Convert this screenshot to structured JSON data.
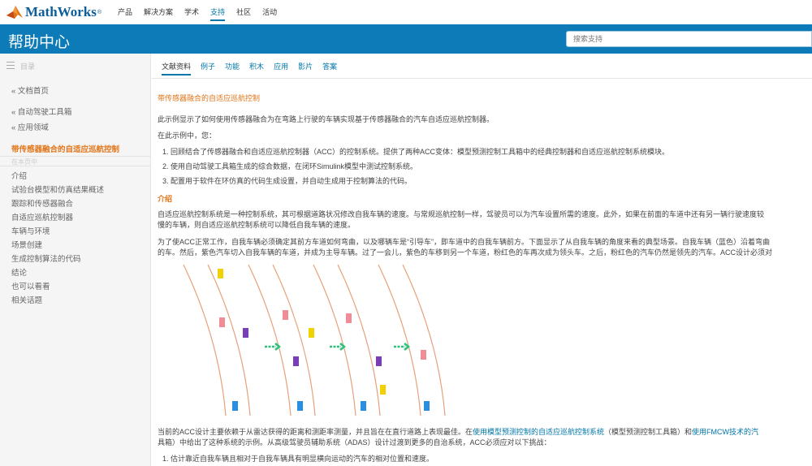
{
  "header": {
    "logo_text": "MathWorks",
    "logo_mark": "®",
    "nav": [
      "产品",
      "解决方案",
      "学术",
      "支持",
      "社区",
      "活动"
    ],
    "active_nav": "支持"
  },
  "banner": {
    "title": "帮助中心",
    "search_placeholder": "搜索支持"
  },
  "sidebar": {
    "head_label": "目录",
    "items": [
      {
        "label": "« 文档首页"
      },
      {
        "label": "« 自动驾驶工具箱"
      },
      {
        "label": "« 应用领域"
      },
      {
        "label": "带传感器融合的自适应巡航控制"
      },
      {
        "label": "介绍"
      },
      {
        "label": "试验台模型和仿真结果概述"
      },
      {
        "label": "跟踪和传感器融合"
      },
      {
        "label": "自适应巡航控制器"
      },
      {
        "label": "车辆与环境"
      },
      {
        "label": "场景创建"
      },
      {
        "label": "生成控制算法的代码"
      },
      {
        "label": "结论"
      },
      {
        "label": "也可以看看"
      },
      {
        "label": "相关话题"
      }
    ],
    "faded_label": "在本页中"
  },
  "tabs": [
    "文献资料",
    "例子",
    "功能",
    "积木",
    "应用",
    "影片",
    "答案"
  ],
  "active_tab": "文献资料",
  "article": {
    "title": "带传感器融合的自适应巡航控制",
    "intro": "此示例显示了如何使用传感器融合为在弯路上行驶的车辆实现基于传感器融合的汽车自适应巡航控制器。",
    "in_this_example": "在此示例中，您：",
    "steps": [
      "1. 回顾结合了传感器融合和自适应巡航控制器（ACC）的控制系统。提供了两种ACC变体：模型预测控制工具箱中的经典控制器和自适应巡航控制系统模块。",
      "2. 使用自动驾驶工具箱生成的综合数据，在闭环Simulink模型中测试控制系统。",
      "3. 配置用于软件在环仿真的代码生成设置，并自动生成用于控制算法的代码。"
    ],
    "section_intro": "介绍",
    "p1_line1": "自适应巡航控制系统是一种控制系统，其可根据道路状况修改自我车辆的速度。与常规巡航控制一样，驾驶员可以为汽车设置所需的速度。此外，如果在前面的车道中还有另一辆行驶速度较",
    "p1_line2": "慢的车辆，则自适应巡航控制系统可以降低自我车辆的速度。",
    "p2_line1": "为了使ACC正常工作，自我车辆必须确定其前方车道如何弯曲，以及哪辆车是“引导车”，即车道中的自我车辆前方。下面显示了从自我车辆的角度来看的典型场景。自我车辆（蓝色）沿着弯曲",
    "p2_line2": "的车。然后，紫色汽车切入自我车辆的车道，并成为主导车辆。过了一会儿，紫色的车移到另一个车道，粉红色的车再次成为领头车。之后，粉红色的汽车仍然是领先的汽车。ACC设计必须对",
    "p3_line1_a": "当前的ACC设计主要依赖于从雷达获得的距离和测距率测量，并且旨在在直行道路上表现最佳。在",
    "p3_line1_link1": "使用模型预测控制的自适应巡航控制系统",
    "p3_line1_b": "（模型预测控制工具箱）和",
    "p3_line1_link2": "使用FMCW技术的汽",
    "p3_line2": "具箱）中给出了这种系统的示例。从高级驾驶员辅助系统（ADAS）设计过渡到更多的自治系统，ACC必须应对以下挑战：",
    "challenge1": "1. 估计靠近自我车辆且相对于自我车辆具有明显横向运动的汽车的相对位置和速度。"
  },
  "figure": {
    "lane_color": "#e8a07a",
    "colors": {
      "ego": "#2b8fe0",
      "purple": "#7a3fb8",
      "pink": "#f08c96",
      "yellow": "#f2d100",
      "arrow": "#2fc27a"
    }
  }
}
